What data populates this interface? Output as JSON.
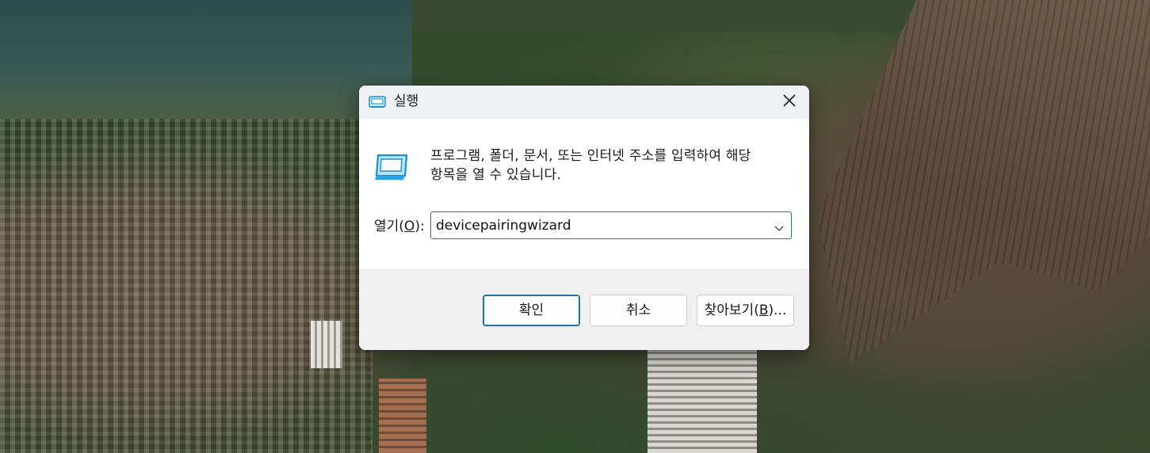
{
  "dialog": {
    "title": "실행",
    "description_line1": "프로그램, 폴더, 문서, 또는 인터넷 주소를 입력하여 해당",
    "description_line2": "항목을 열 수 있습니다.",
    "open_label": "열기(",
    "open_label_accel": "O",
    "open_label_suffix": "):",
    "input_value": "devicepairingwizard",
    "buttons": {
      "ok": "확인",
      "cancel": "취소",
      "browse_prefix": "찾아보기(",
      "browse_accel": "B",
      "browse_suffix": ")..."
    }
  },
  "icons": {
    "title_icon": "run-icon",
    "main_icon": "run-icon",
    "close": "close-icon",
    "dropdown": "chevron-down-icon"
  },
  "colors": {
    "accent": "#1f6fb0",
    "icon_blue": "#2aa3e8"
  }
}
